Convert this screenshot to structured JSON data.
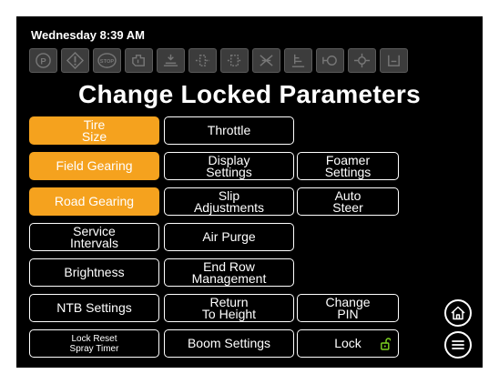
{
  "status": {
    "datetime": "Wednesday 8:39 AM"
  },
  "indicators": [
    "parking-brake-icon",
    "warning-icon",
    "stop-icon",
    "engine-icon",
    "spray-icon",
    "filter-icon",
    "fuel-filter-icon",
    "spray-off-icon",
    "level-icon",
    "transmission-icon",
    "pump-icon",
    "tank-icon"
  ],
  "title": "Change Locked Parameters",
  "buttons": {
    "tire_size": "Tire\nSize",
    "throttle": "Throttle",
    "field_gearing": "Field Gearing",
    "display_settings": "Display\nSettings",
    "foamer_settings": "Foamer\nSettings",
    "road_gearing": "Road Gearing",
    "slip_adjustments": "Slip\nAdjustments",
    "auto_steer": "Auto\nSteer",
    "service_intervals": "Service\nIntervals",
    "air_purge": "Air Purge",
    "brightness": "Brightness",
    "end_row_management": "End Row\nManagement",
    "ntb_settings": "NTB Settings",
    "return_to_height": "Return\nTo Height",
    "change_pin": "Change\nPIN",
    "lock_reset_spray_timer": "Lock Reset\nSpray Timer",
    "boom_settings": "Boom Settings",
    "lock": "Lock"
  },
  "colors": {
    "active": "#f5a21e",
    "lock_icon": "#7ed321",
    "indicator_bg": "#3c3c3c"
  }
}
